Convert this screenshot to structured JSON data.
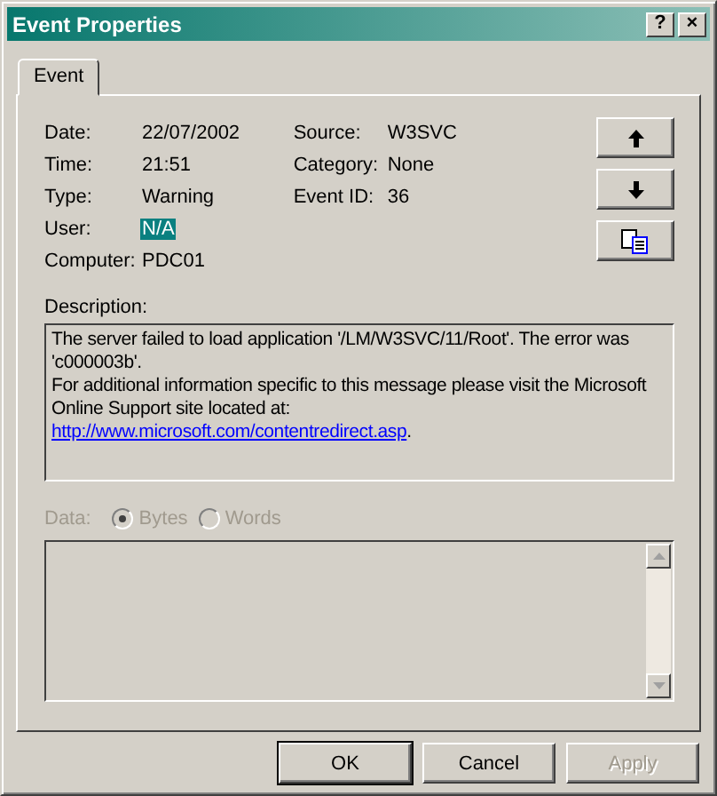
{
  "window": {
    "title": "Event Properties",
    "help_button": "?",
    "close_button": "×"
  },
  "tabs": [
    {
      "label": "Event",
      "selected": true
    }
  ],
  "fields": [
    {
      "label": "Date:",
      "value": "22/07/2002",
      "selected": false
    },
    {
      "label": "Time:",
      "value": "21:51",
      "selected": false
    },
    {
      "label": "Type:",
      "value": "Warning",
      "selected": false
    },
    {
      "label": "User:",
      "value": "N/A",
      "selected": true
    },
    {
      "label": "Computer:",
      "value": "PDC01",
      "selected": false
    }
  ],
  "fields_right": [
    {
      "label": "Source:",
      "value": "W3SVC"
    },
    {
      "label": "Category:",
      "value": "None"
    },
    {
      "label": "Event ID:",
      "value": "36"
    }
  ],
  "side_buttons": [
    {
      "kind": "up"
    },
    {
      "kind": "down"
    },
    {
      "kind": "copy"
    }
  ],
  "description": {
    "label": "Description:",
    "text": "The server failed to load application '/LM/W3SVC/11/Root'.  The error was 'c000003b'.\nFor additional information specific to this message please visit the Microsoft Online Support site located at:",
    "link": "http://www.microsoft.com/contentredirect.asp",
    "after_link": "."
  },
  "data": {
    "label": "Data:",
    "disabled": true,
    "options": [
      {
        "label": "Bytes",
        "selected": true
      },
      {
        "label": "Words",
        "selected": false
      }
    ]
  },
  "buttons": [
    {
      "label": "OK",
      "default": true,
      "disabled": false
    },
    {
      "label": "Cancel",
      "default": false,
      "disabled": false
    },
    {
      "label": "Apply",
      "default": false,
      "disabled": true
    }
  ]
}
